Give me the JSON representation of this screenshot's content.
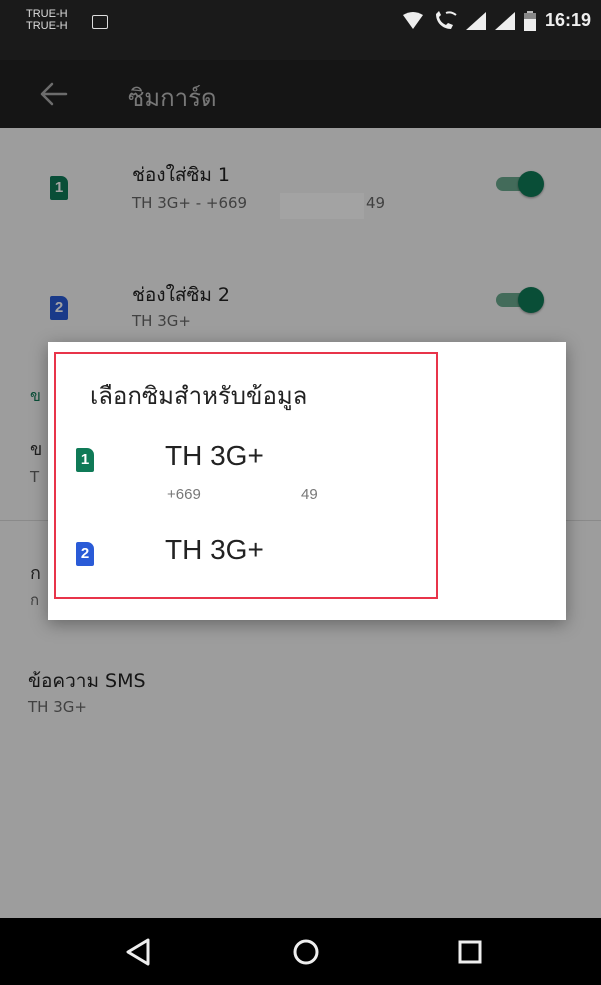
{
  "status_bar": {
    "carrier_1": "TRUE-H",
    "carrier_2": "TRUE-H",
    "time": "16:19"
  },
  "app_bar": {
    "title": "ซิมการ์ด",
    "back_icon": "arrow-left-icon"
  },
  "settings": {
    "sim_slot_1": {
      "title": "ช่องใส่ซิม 1",
      "subtitle": "TH 3G+ - +669",
      "suffix": "49",
      "enabled": true,
      "badge": "1"
    },
    "sim_slot_2": {
      "title": "ช่องใส่ซิม 2",
      "subtitle": "TH 3G+",
      "enabled": true,
      "badge": "2"
    },
    "partial_section": "ข",
    "partial_row_1": {
      "title": "ข",
      "subtitle": "T"
    },
    "partial_row_2": {
      "title": "ก",
      "subtitle": "ก"
    },
    "sms": {
      "title": "ข้อความ SMS",
      "subtitle": "TH 3G+"
    }
  },
  "dialog": {
    "title": "เลือกซิมสำหรับข้อมูล",
    "options": [
      {
        "badge": "1",
        "label": "TH 3G+",
        "number_prefix": "+669",
        "number_suffix": "49"
      },
      {
        "badge": "2",
        "label": "TH 3G+"
      }
    ]
  },
  "nav_bar": {
    "back_icon": "triangle-back-icon",
    "home_icon": "circle-home-icon",
    "recents_icon": "square-recents-icon"
  },
  "colors": {
    "sim1": "#0f7a57",
    "sim2": "#2a5bd7",
    "highlight": "#e8344a"
  }
}
